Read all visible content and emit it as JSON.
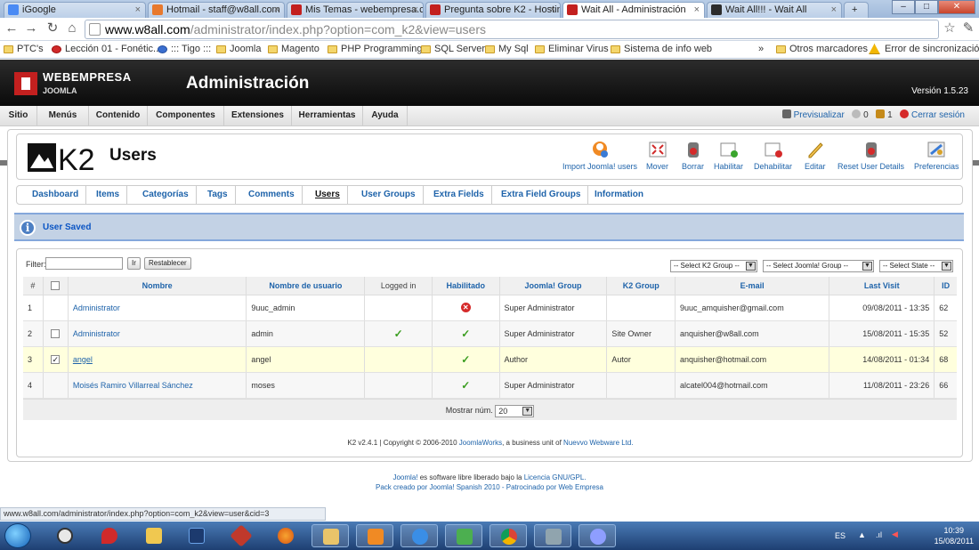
{
  "browser": {
    "tabs": [
      {
        "label": "iGoogle",
        "color": "#4a8af4"
      },
      {
        "label": "Hotmail - staff@w8all.com",
        "color": "#e8792d"
      },
      {
        "label": "Mis Temas - webempresa.co",
        "color": "#c3201f"
      },
      {
        "label": "Pregunta sobre K2 - Hosting",
        "color": "#c3201f"
      },
      {
        "label": "Wait All - Administración",
        "color": "#c3201f"
      },
      {
        "label": "Wait All!!! - Wait All",
        "color": "#2c2c2c"
      }
    ],
    "url_host": "www.w8all.com",
    "url_path": "/administrator/index.php?option=com_k2&view=users",
    "bookmarks": [
      "PTC's",
      "Lección 01 - Fonétic...",
      "::: Tigo :::",
      "Joomla",
      "Magento",
      "PHP Programming",
      "SQL Server",
      "My Sql",
      "Eliminar Virus",
      "Sistema de info web"
    ],
    "bookmarks_more": "»",
    "other_bookmarks": "Otros marcadores",
    "sync_error": "Error de sincronización"
  },
  "joomla": {
    "brand": "WEBEMPRESA",
    "brand_sub": "JOOMLA",
    "title": "Administración",
    "version": "Versión 1.5.23",
    "menu": [
      "Sitio",
      "Menús",
      "Contenido",
      "Componentes",
      "Extensiones",
      "Herramientas",
      "Ayuda"
    ],
    "preview": "Previsualizar",
    "messages_count": "0",
    "users_count": "1",
    "logout": "Cerrar sesión"
  },
  "k2": {
    "logo_text": "K2",
    "page_title": "Users",
    "toolbar": [
      {
        "label": "Import Joomla! users",
        "icon": "import-icon"
      },
      {
        "label": "Mover",
        "icon": "move-icon"
      },
      {
        "label": "Borrar",
        "icon": "delete-icon"
      },
      {
        "label": "Habilitar",
        "icon": "enable-icon"
      },
      {
        "label": "Dehabilitar",
        "icon": "disable-icon"
      },
      {
        "label": "Editar",
        "icon": "edit-icon"
      },
      {
        "label": "Reset User Details",
        "icon": "reset-icon"
      },
      {
        "label": "Preferencias",
        "icon": "preferences-icon"
      }
    ],
    "subnav": [
      "Dashboard",
      "Items",
      "Categorías",
      "Tags",
      "Comments",
      "Users",
      "User Groups",
      "Extra Fields",
      "Extra Field Groups",
      "Information"
    ],
    "subnav_current": "Users",
    "message": "User Saved",
    "filter": {
      "label": "Filter:",
      "value": "",
      "go": "Ir",
      "reset": "Restablecer"
    },
    "selects": {
      "k2_group": "-- Select K2 Group --",
      "joomla_group": "-- Select Joomla! Group --",
      "state": "-- Select State --"
    },
    "columns": [
      "#",
      "",
      "Nombre",
      "Nombre de usuario",
      "Logged in",
      "Habilitado",
      "Joomla! Group",
      "K2 Group",
      "E-mail",
      "Last Visit",
      "ID"
    ],
    "rows": [
      {
        "num": "1",
        "checkbox": "none",
        "name": "Administrator",
        "username": "9uuc_admin",
        "logged_in": false,
        "enabled": false,
        "joomla_group": "Super Administrator",
        "k2_group": "",
        "email": "9uuc_amquisher@gmail.com",
        "last_visit": "09/08/2011 - 13:35",
        "id": "62"
      },
      {
        "num": "2",
        "checkbox": "unchecked",
        "name": "Administrator",
        "username": "admin",
        "logged_in": true,
        "enabled": true,
        "joomla_group": "Super Administrator",
        "k2_group": "Site Owner",
        "email": "anquisher@w8all.com",
        "last_visit": "15/08/2011 - 15:35",
        "id": "52"
      },
      {
        "num": "3",
        "checkbox": "checked",
        "name": "angel",
        "username": "angel",
        "logged_in": false,
        "enabled": true,
        "joomla_group": "Author",
        "k2_group": "Autor",
        "email": "anquisher@hotmail.com",
        "last_visit": "14/08/2011 - 01:34",
        "id": "68"
      },
      {
        "num": "4",
        "checkbox": "none",
        "name": "Moisés Ramiro Villarreal Sánchez",
        "username": "moses",
        "logged_in": false,
        "enabled": true,
        "joomla_group": "Super Administrator",
        "k2_group": "",
        "email": "alcatel004@hotmail.com",
        "last_visit": "11/08/2011 - 23:26",
        "id": "66"
      }
    ],
    "pager_label": "Mostrar núm.",
    "pager_value": "20",
    "footer_prefix": "K2 v2.4.1 | Copyright © 2006-2010",
    "footer_link1": "JoomlaWorks",
    "footer_mid": ", a business unit of",
    "footer_link2": "Nuevvo Webware Ltd."
  },
  "footer": {
    "joomla": "Joomla!",
    "line1_mid": " es software libre liberado bajo la ",
    "license": "Licencia GNU/GPL.",
    "line2": "Pack creado por Joomla! Spanish 2010 - Patrocinado por Web Empresa"
  },
  "status_url": "www.w8all.com/administrator/index.php?option=com_k2&view=user&cid=3",
  "taskbar": {
    "apps": [
      "clock",
      "pin",
      "folder",
      "photoshop",
      "app",
      "firefox",
      "explorer",
      "media",
      "ie",
      "network",
      "chrome",
      "drive",
      "paint"
    ],
    "lang": "ES",
    "time": "10:39",
    "date": "15/08/2011"
  },
  "colors": {
    "link": "#1e63aa",
    "joomla_red": "#c3201f",
    "message_bg": "#c3d2e5"
  }
}
